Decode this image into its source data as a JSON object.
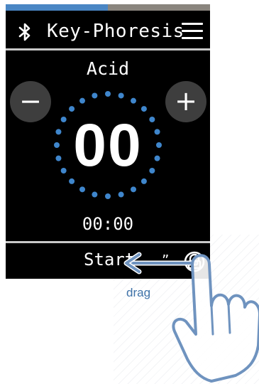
{
  "device": {
    "progress_fraction": 0.5,
    "header": {
      "title": "Key-Phoresis",
      "left_icon": "bluetooth-icon",
      "right_icon": "hamburger-menu-icon"
    },
    "mode": "Acid",
    "decrement_label": "−",
    "increment_label": "+",
    "count_value": "00",
    "timer_value": "00:00",
    "footer": {
      "start_label": "Start",
      "slider_marks": "”",
      "handle_icon": "lock-handle-icon"
    }
  },
  "annotation": {
    "label": "drag",
    "gesture_icon": "hand-pointer-icon",
    "arrow_icon": "left-arrow-icon"
  },
  "colors": {
    "screen_bg": "#000000",
    "progress_fill": "#4a86c4",
    "progress_track": "#8a857e",
    "dial_dots": "#3f86cc",
    "button_bg": "#3e3e3e",
    "annotation_blue": "#6f93bf"
  }
}
